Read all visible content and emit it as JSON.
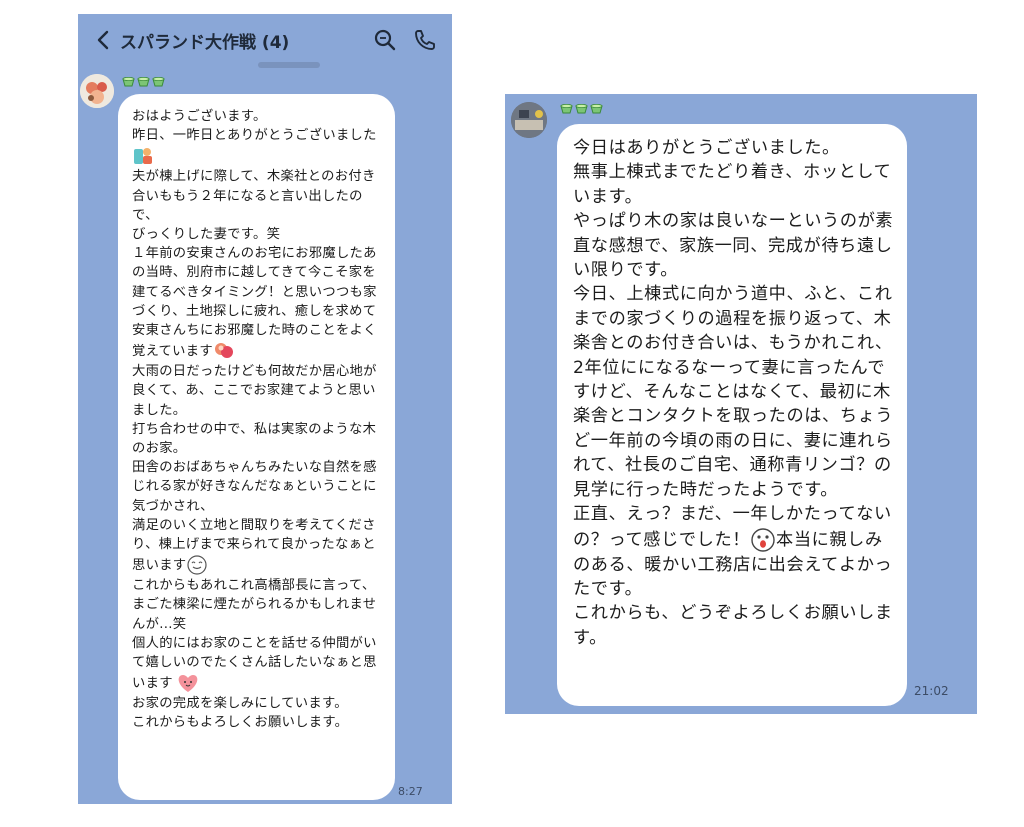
{
  "left_chat": {
    "title": "スパランド大作戦 (4)",
    "time": "8:27",
    "message": {
      "p1": "おはようございます。\n昨日、一昨日とありがとうございました",
      "p2": "\n夫が棟上げに際して、木楽社とのお付き合いももう２年になると言い出したので、\nびっくりした妻です。笑\n１年前の安東さんのお宅にお邪魔したあの当時、別府市に越してきて今こそ家を建てるべきタイミング！と思いつつも家づくり、土地探しに疲れ、癒しを求めて安東さんちにお邪魔した時のことをよく覚えています",
      "p3": "\n大雨の日だったけども何故だか居心地が良くて、あ、ここでお家建てようと思いました。\n打ち合わせの中で、私は実家のような木のお家。\n田舎のおばあちゃんちみたいな自然を感じれる家が好きなんだなぁということに気づかされ、\n満足のいく立地と間取りを考えてくださり、棟上げまで来られて良かったなぁと思います",
      "p4": "\nこれからもあれこれ高橋部長に言って、まごた棟梁に煙たがられるかもしれませんが...笑\n個人的にはお家のことを話せる仲間がいて嬉しいのでたくさん話したいなぁと思います",
      "p5": "\nお家の完成を楽しみにしています。\nこれからもよろしくお願いします。"
    }
  },
  "right_chat": {
    "time": "21:02",
    "message": {
      "p1": "今日はありがとうございました。\n無事上棟式までたどり着き、ホッとしています。\nやっぱり木の家は良いなーというのが素直な感想で、家族一同、完成が待ち遠しい限りです。\n今日、上棟式に向かう道中、ふと、これまでの家づくりの過程を振り返って、木楽舎とのお付き合いは、もうかれこれ、2年位にになるなーって妻に言ったんですけど、そんなことはなくて、最初に木楽舎とコンタクトを取ったのは、ちょうど一年前の今頃の雨の日に、妻に連れられて、社長のご自宅、通称青リンゴ？の見学に行った時だったようです。\n正直、えっ？まだ、一年しかたってないの？って感じでした！",
      "p2": "本当に親しみのある、暖かい工務店に出会えてよかったです。\nこれからも、どうぞよろしくお願いします。"
    }
  },
  "icons": {
    "back": "chevron-left-icon",
    "search": "search-icon",
    "call": "phone-icon",
    "sender_badge": "green-cup-icon"
  },
  "colors": {
    "chat_background": "#8aa7d7",
    "bubble": "#ffffff"
  }
}
